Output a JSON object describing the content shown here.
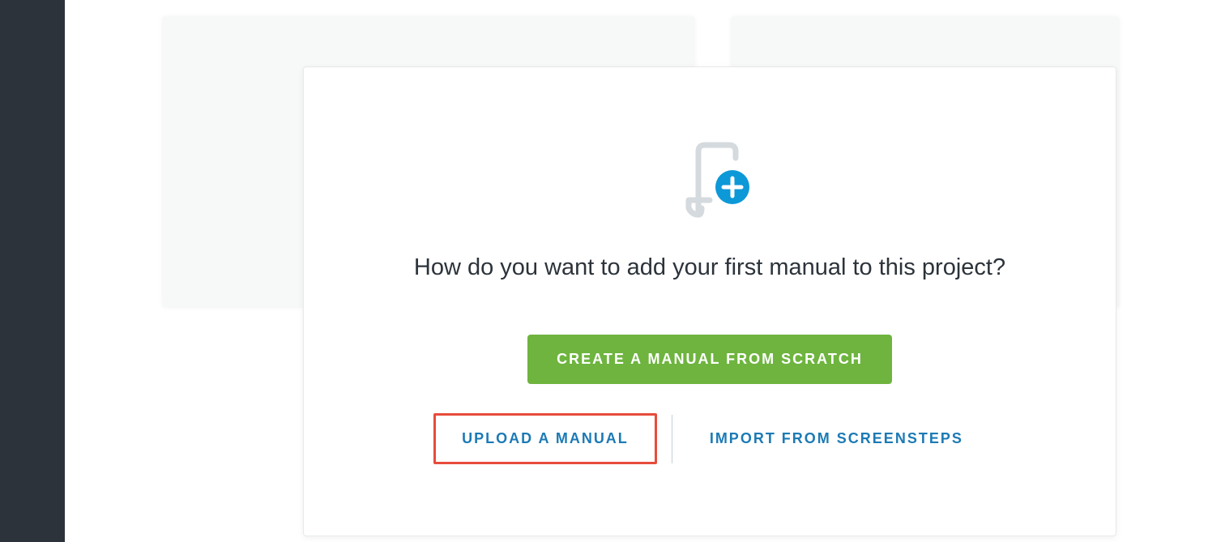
{
  "colors": {
    "sidebar": "#2c333a",
    "primary_button": "#6eb43f",
    "link": "#1c7ab5",
    "highlight_border": "#e74c3c",
    "icon_accent": "#0d98d8"
  },
  "modal": {
    "heading": "How do you want to add your first manual to this project?",
    "create_label": "CREATE A MANUAL FROM SCRATCH",
    "upload_label": "UPLOAD A MANUAL",
    "import_label": "IMPORT FROM SCREENSTEPS"
  }
}
